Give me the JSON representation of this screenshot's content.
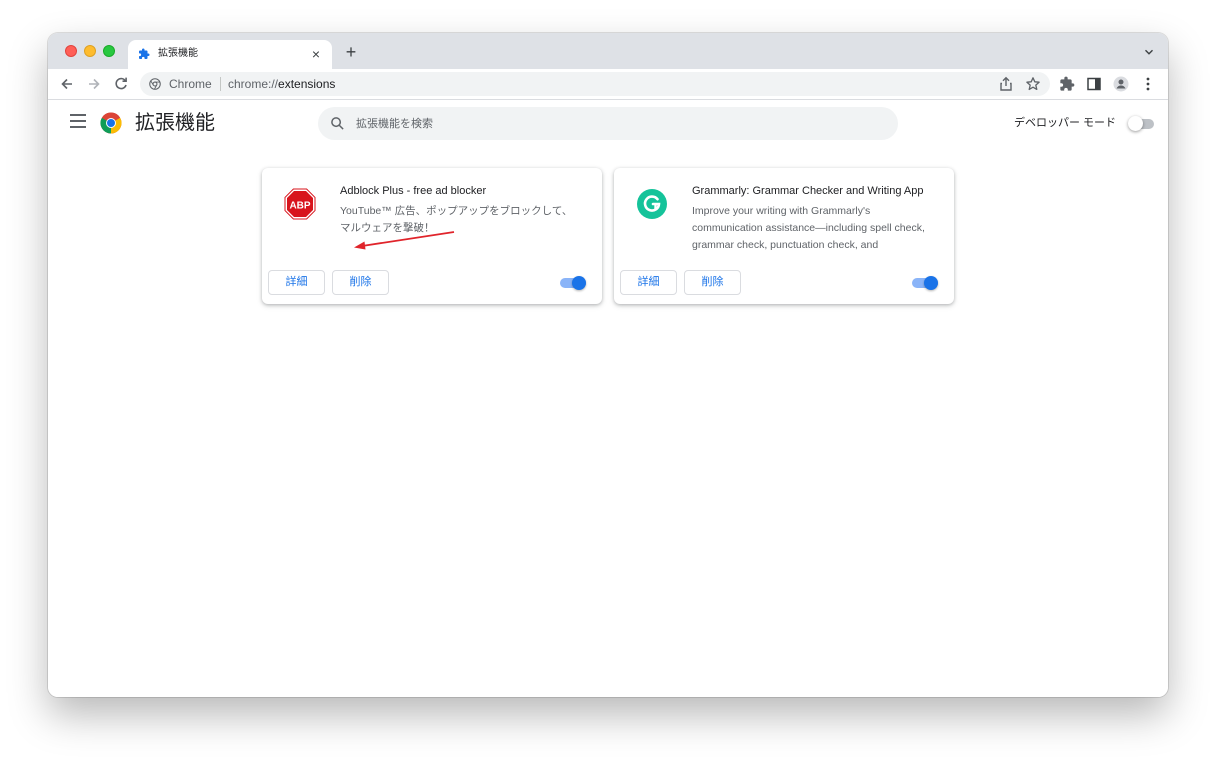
{
  "tab": {
    "title": "拡張機能",
    "close_symbol": "×",
    "new_tab_symbol": "+"
  },
  "omnibox": {
    "site_label": "Chrome",
    "url_scheme": "chrome://",
    "url_path": "extensions"
  },
  "page": {
    "title": "拡張機能",
    "search_placeholder": "拡張機能を検索",
    "developer_mode_label": "デベロッパー モード",
    "developer_mode_on": false
  },
  "extensions": [
    {
      "name": "Adblock Plus - free ad blocker",
      "description": "YouTube™ 広告、ポップアップをブロックして、マルウェアを撃破！",
      "icon": "abp-stop-sign-icon",
      "icon_text": "ABP",
      "details_label": "詳細",
      "remove_label": "削除",
      "enabled": true
    },
    {
      "name": "Grammarly: Grammar Checker and Writing App",
      "description": "Improve your writing with Grammarly's communication assistance—including spell check, grammar check, punctuation check, and",
      "icon": "grammarly-icon",
      "details_label": "詳細",
      "remove_label": "削除",
      "enabled": true
    }
  ],
  "colors": {
    "accent": "#1a73e8",
    "toggle_track_on": "#8ab4f8",
    "abp_red": "#d8141c",
    "grammarly_green": "#15c39a",
    "annotation_arrow": "#e0242b"
  }
}
